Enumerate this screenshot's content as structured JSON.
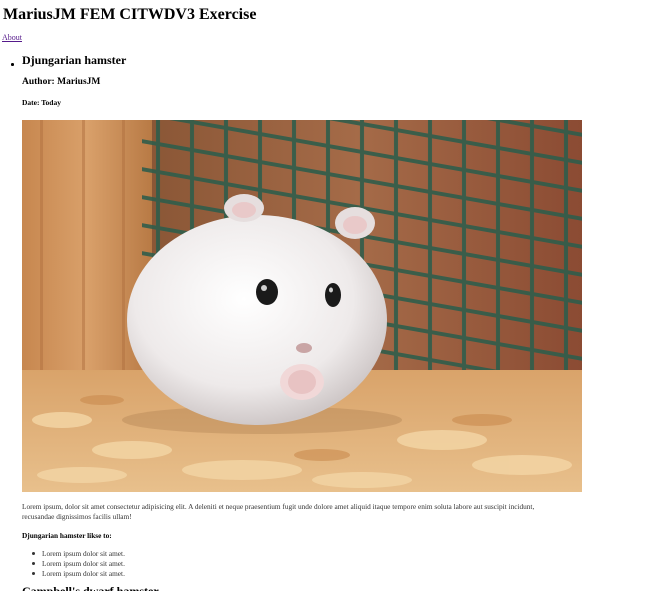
{
  "header": {
    "title": "MariusJM FEM CITWDV3 Exercise",
    "about_link": "About"
  },
  "post": {
    "title": "Djungarian hamster",
    "author": "Author: MariusJM",
    "date": "Date: Today",
    "body": "Lorem ipsum, dolor sit amet consectetur adipisicing elit. A deleniti et neque praesentium fugit unde dolore amet aliquid itaque tempore enim soluta labore aut suscipit incidunt, recusandae dignissimos facilis ullam!",
    "likes_heading": "Djungarian hamster likse to:",
    "likes": [
      "Lorem ipsum dolor sit amet.",
      "Lorem ipsum dolor sit amet.",
      "Lorem ipsum dolor sit amet."
    ]
  },
  "next_post": {
    "title": "Campbell's dwarf hamster"
  }
}
